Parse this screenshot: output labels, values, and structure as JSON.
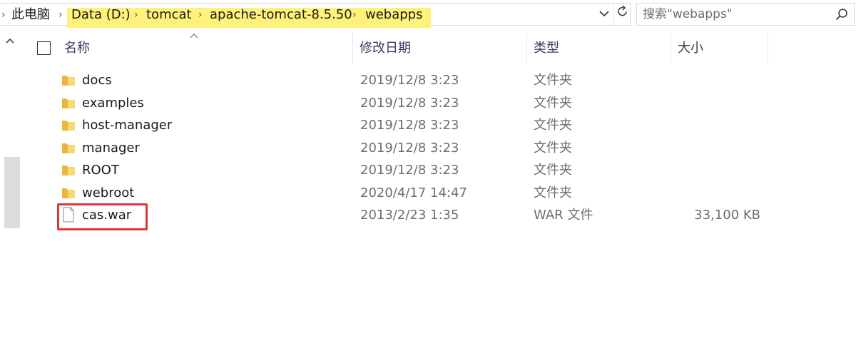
{
  "address_bar": {
    "breadcrumbs": [
      "此电脑",
      "Data (D:)",
      "tomcat",
      "apache-tomcat-8.5.50",
      "webapps"
    ],
    "highlight_color": "#fef27a"
  },
  "search": {
    "placeholder": "搜索\"webapps\""
  },
  "columns": {
    "name": "名称",
    "date_modified": "修改日期",
    "type": "类型",
    "size": "大小"
  },
  "files": [
    {
      "name": "docs",
      "date": "2019/12/8 3:23",
      "type": "文件夹",
      "size": "",
      "icon": "folder-icon"
    },
    {
      "name": "examples",
      "date": "2019/12/8 3:23",
      "type": "文件夹",
      "size": "",
      "icon": "folder-icon"
    },
    {
      "name": "host-manager",
      "date": "2019/12/8 3:23",
      "type": "文件夹",
      "size": "",
      "icon": "folder-icon"
    },
    {
      "name": "manager",
      "date": "2019/12/8 3:23",
      "type": "文件夹",
      "size": "",
      "icon": "folder-icon"
    },
    {
      "name": "ROOT",
      "date": "2019/12/8 3:23",
      "type": "文件夹",
      "size": "",
      "icon": "folder-icon"
    },
    {
      "name": "webroot",
      "date": "2020/4/17 14:47",
      "type": "文件夹",
      "size": "",
      "icon": "folder-icon"
    },
    {
      "name": "cas.war",
      "date": "2013/2/23 1:35",
      "type": "WAR 文件",
      "size": "33,100 KB",
      "icon": "file-icon"
    }
  ],
  "annotation": {
    "color": "#e0343d",
    "target": "cas.war"
  }
}
